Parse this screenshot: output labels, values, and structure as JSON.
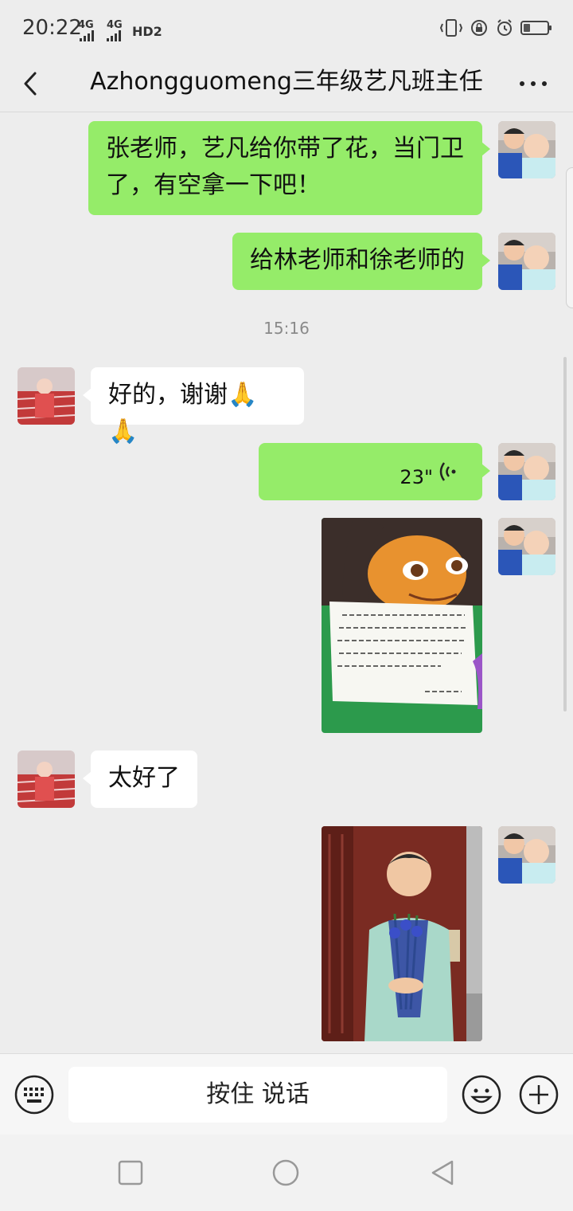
{
  "status_bar": {
    "time": "20:22",
    "signal_1": "4G",
    "signal_2": "4G",
    "hd": "HD2"
  },
  "nav": {
    "title": "Azhongguomeng三年级艺凡班主任"
  },
  "messages": [
    {
      "from": "me",
      "type": "text",
      "text": "张老师，艺凡给你带了花，当门卫了，有空拿一下吧！"
    },
    {
      "from": "me",
      "type": "text",
      "text": "给林老师和徐老师的"
    },
    {
      "type": "timestamp",
      "text": "15:16"
    },
    {
      "from": "them",
      "type": "text",
      "text": "好的，谢谢🙏🙏"
    },
    {
      "from": "me",
      "type": "voice",
      "duration": "23\""
    },
    {
      "from": "me",
      "type": "image",
      "subject": "cartoon-card-with-handwritten-note"
    },
    {
      "from": "them",
      "type": "text",
      "text": "太好了"
    },
    {
      "from": "me",
      "type": "image",
      "subject": "boy-holding-flowers"
    }
  ],
  "input_bar": {
    "talk_label": "按住 说话"
  },
  "colors": {
    "background": "#ededed",
    "my_bubble": "#95ec69",
    "their_bubble": "#ffffff"
  }
}
